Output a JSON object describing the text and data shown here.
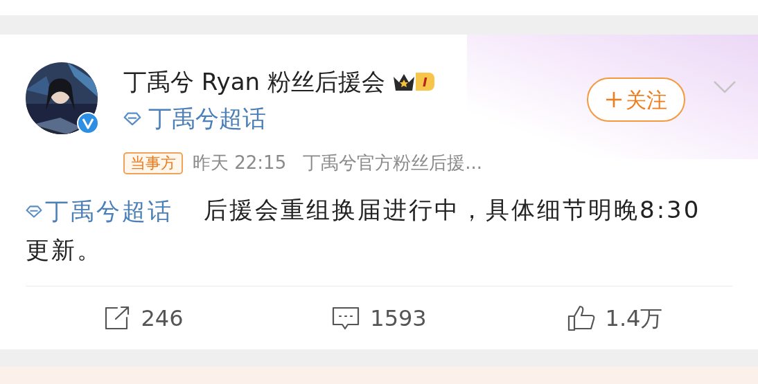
{
  "post": {
    "author": {
      "name": "丁禹兮 Ryan 粉丝后援会",
      "level_badge": "I",
      "verified": true,
      "topic": "丁禹兮超话"
    },
    "follow_button": "关注",
    "meta": {
      "tag": "当事方",
      "time": "昨天 22:15",
      "source": "丁禹兮官方粉丝后援..."
    },
    "content": {
      "topic_link": "丁禹兮超话",
      "text": "后援会重组换届进行中，具体细节明晚8:30 更新。"
    },
    "actions": [
      {
        "kind": "share",
        "count": "246"
      },
      {
        "kind": "comment",
        "count": "1593"
      },
      {
        "kind": "like",
        "count": "1.4万"
      }
    ]
  }
}
